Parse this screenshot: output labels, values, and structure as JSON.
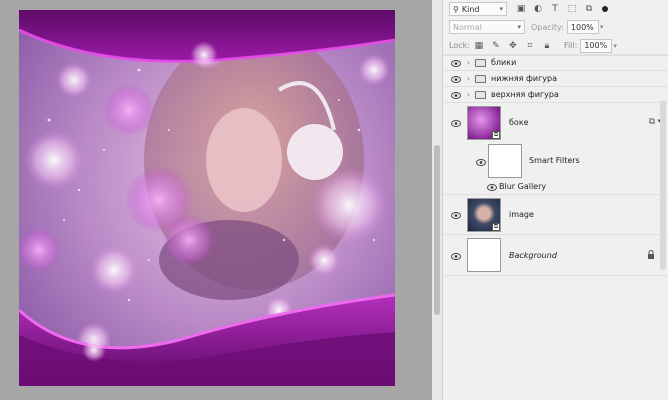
{
  "layers_panel": {
    "filter": {
      "kind_label": "Kind"
    },
    "blend_mode": "Normal",
    "opacity": {
      "label": "Opacity:",
      "value": "100%"
    },
    "lock": {
      "label": "Lock:"
    },
    "fill": {
      "label": "Fill:",
      "value": "100%"
    },
    "layers": [
      {
        "name": "блики",
        "type": "group",
        "visible": true
      },
      {
        "name": "нижняя фигура",
        "type": "group",
        "visible": true
      },
      {
        "name": "верхняя фигура",
        "type": "group",
        "visible": true
      },
      {
        "name": "боке",
        "type": "smart-object",
        "visible": true,
        "selected": true
      },
      {
        "name": "Smart Filters",
        "type": "smart-filters",
        "visible": true
      },
      {
        "name": "Blur Gallery",
        "type": "filter",
        "visible": true
      },
      {
        "name": "image",
        "type": "smart-object",
        "visible": true
      },
      {
        "name": "Background",
        "type": "background",
        "visible": true,
        "locked": true
      }
    ]
  },
  "colors": {
    "accent_magenta": "#b020b8",
    "deep_purple": "#6a0c72",
    "panel_bg": "#f0f0f0",
    "canvas_bg": "#a6a6a6"
  }
}
